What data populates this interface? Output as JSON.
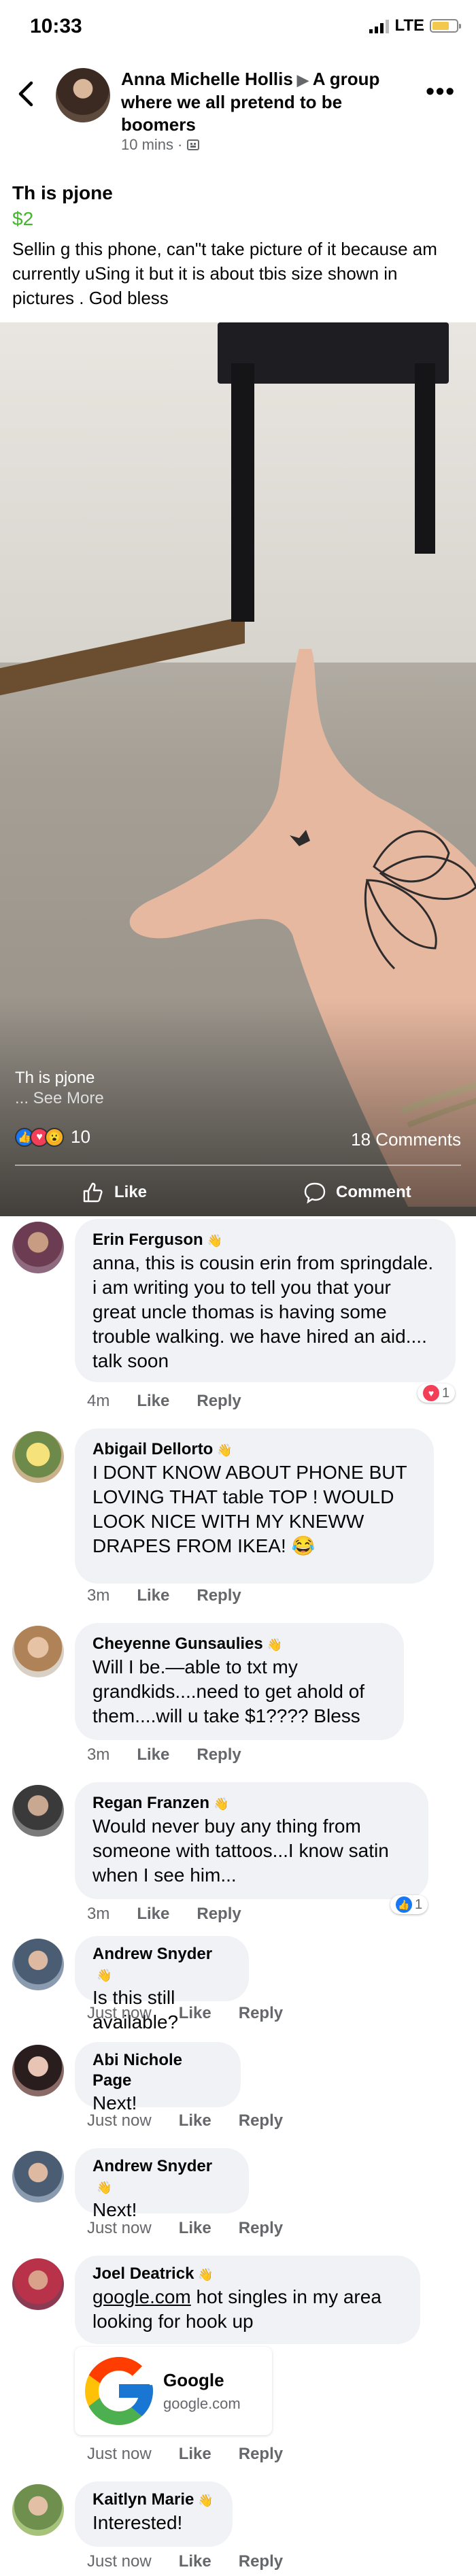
{
  "status_bar": {
    "time": "10:33",
    "network": "LTE"
  },
  "header": {
    "author": "Anna Michelle Hollis",
    "group": "A group where we all pretend to be boomers",
    "time": "10 mins",
    "privacy_icon": "group-icon",
    "more_icon": "more-options-icon"
  },
  "post": {
    "title": "Th is pjone",
    "price": "$2",
    "body": "Sellin g this phone, can\"t take picture of it because am currently uSing it but it is about tbis size shown in pictures . God bless",
    "caption_title": "Th is pjone",
    "caption_more": "... See More",
    "reaction_count": "10",
    "comments_count": "18 Comments",
    "like_label": "Like",
    "comment_label": "Comment",
    "colors": {
      "price": "#42b72a",
      "like": "#1877f2",
      "love": "#f33e58",
      "wow": "#f7b125"
    }
  },
  "comments": [
    {
      "name": "Erin Ferguson",
      "text": "anna, this is cousin erin from springdale. i am writing you to tell you that your great uncle thomas is having some trouble walking. we have hired an aid.... talk soon",
      "time": "4m",
      "like": "Like",
      "reply": "Reply",
      "reaction": {
        "type": "love",
        "count": "1"
      }
    },
    {
      "name": "Abigail Dellorto",
      "text": "I DONT KNOW ABOUT PHONE BUT LOVING THAT table TOP ! WOULD LOOK NICE WITH MY KNEWW DRAPES FROM IKEA! 😂",
      "time": "3m",
      "like": "Like",
      "reply": "Reply"
    },
    {
      "name": "Cheyenne Gunsaulies",
      "text": "Will I be.—able to txt my grandkids....need to get ahold of them....will u take $1???? Bless",
      "time": "3m",
      "like": "Like",
      "reply": "Reply"
    },
    {
      "name": "Regan Franzen",
      "text": "Would never buy any thing from someone with tattoos...I know satin when I see him...",
      "time": "3m",
      "like": "Like",
      "reply": "Reply",
      "reaction": {
        "type": "like",
        "count": "1"
      }
    },
    {
      "name": "Andrew Snyder",
      "text": "Is this still available?",
      "time": "Just now",
      "like": "Like",
      "reply": "Reply"
    },
    {
      "name": "Abi Nichole Page",
      "text": "Next!",
      "time": "Just now",
      "like": "Like",
      "reply": "Reply"
    },
    {
      "name": "Andrew Snyder",
      "text": "Next!",
      "time": "Just now",
      "like": "Like",
      "reply": "Reply"
    },
    {
      "name": "Joel Deatrick",
      "link_text": "google.com",
      "text": " hot singles in my area looking for hook up",
      "time": "Just now",
      "like": "Like",
      "reply": "Reply",
      "link_card": {
        "title": "Google",
        "domain": "google.com"
      }
    },
    {
      "name": "Kaitlyn Marie",
      "text": "Interested!",
      "time": "Just now",
      "like": "Like",
      "reply": "Reply"
    }
  ]
}
